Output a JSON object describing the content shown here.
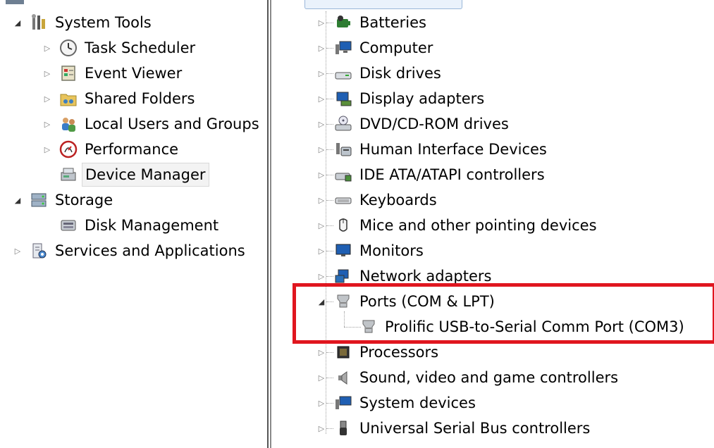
{
  "left_tree": {
    "items": [
      {
        "label": "System Tools",
        "expander": "open",
        "icon": "toolbox-icon"
      },
      {
        "label": "Task Scheduler",
        "expander": "closed",
        "icon": "clock-icon"
      },
      {
        "label": "Event Viewer",
        "expander": "closed",
        "icon": "event-log-icon"
      },
      {
        "label": "Shared Folders",
        "expander": "closed",
        "icon": "shared-folder-icon"
      },
      {
        "label": "Local Users and Groups",
        "expander": "closed",
        "icon": "users-icon"
      },
      {
        "label": "Performance",
        "expander": "closed",
        "icon": "performance-icon"
      },
      {
        "label": "Device Manager",
        "expander": "none",
        "icon": "device-manager-icon",
        "selected": true
      },
      {
        "label": "Storage",
        "expander": "open",
        "icon": "storage-icon"
      },
      {
        "label": "Disk Management",
        "expander": "none",
        "icon": "disk-management-icon"
      },
      {
        "label": "Services and Applications",
        "expander": "closed",
        "icon": "services-icon"
      }
    ]
  },
  "device_tree": {
    "items": [
      {
        "label": "Batteries",
        "icon": "battery-icon"
      },
      {
        "label": "Computer",
        "icon": "computer-icon"
      },
      {
        "label": "Disk drives",
        "icon": "disk-drive-icon"
      },
      {
        "label": "Display adapters",
        "icon": "display-adapter-icon"
      },
      {
        "label": "DVD/CD-ROM drives",
        "icon": "dvd-drive-icon"
      },
      {
        "label": "Human Interface Devices",
        "icon": "hid-icon"
      },
      {
        "label": "IDE ATA/ATAPI controllers",
        "icon": "ide-controller-icon"
      },
      {
        "label": "Keyboards",
        "icon": "keyboard-icon"
      },
      {
        "label": "Mice and other pointing devices",
        "icon": "mouse-icon"
      },
      {
        "label": "Monitors",
        "icon": "monitor-icon"
      },
      {
        "label": "Network adapters",
        "icon": "network-adapter-icon"
      },
      {
        "label": "Ports (COM & LPT)",
        "icon": "port-icon",
        "expanded": true
      },
      {
        "label": "Prolific USB-to-Serial Comm Port (COM3)",
        "icon": "port-icon",
        "child": true
      },
      {
        "label": "Processors",
        "icon": "processor-icon"
      },
      {
        "label": "Sound, video and game controllers",
        "icon": "speaker-icon"
      },
      {
        "label": "System devices",
        "icon": "system-device-icon"
      },
      {
        "label": "Universal Serial Bus controllers",
        "icon": "usb-icon"
      }
    ]
  },
  "highlight": {
    "color": "#e0161f"
  }
}
